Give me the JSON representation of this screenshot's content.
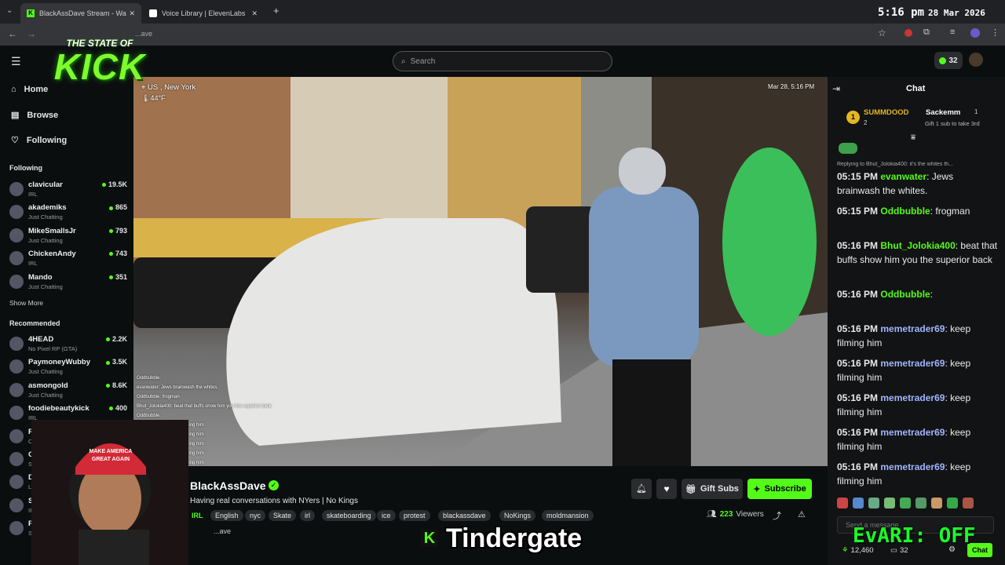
{
  "browser": {
    "tabs": [
      {
        "label": "BlackAssDave Stream - Wa"
      },
      {
        "label": "Voice Library | ElevenLabs"
      }
    ],
    "url": "...ave",
    "clock": "5:16 pm",
    "date": "28 Mar 2026"
  },
  "overlay": {
    "logo_top": "THE STATE OF",
    "logo_main": "KICK",
    "caption": "Tindergate",
    "caption_icon": "K",
    "evari": "EvARI: OFF"
  },
  "kick_header": {
    "search_placeholder": "Search",
    "kicks": "32"
  },
  "sidebar": {
    "nav": [
      {
        "label": "Home"
      },
      {
        "label": "Browse"
      },
      {
        "label": "Following"
      }
    ],
    "following_title": "Following",
    "following": [
      {
        "name": "clavicular",
        "category": "IRL",
        "viewers": "19.5K"
      },
      {
        "name": "akademiks",
        "category": "Just Chatting",
        "viewers": "865"
      },
      {
        "name": "MikeSmallsJr",
        "category": "Just Chatting",
        "viewers": "793"
      },
      {
        "name": "ChickenAndy",
        "category": "IRL",
        "viewers": "743"
      },
      {
        "name": "Mando",
        "category": "Just Chatting",
        "viewers": "351"
      }
    ],
    "show_more": "Show More",
    "recommended_title": "Recommended",
    "recommended": [
      {
        "name": "4HEAD",
        "category": "No Pixel RP (GTA)",
        "viewers": "2.2K"
      },
      {
        "name": "PaymoneyWubby",
        "category": "Just Chatting",
        "viewers": "3.5K"
      },
      {
        "name": "asmongold",
        "category": "Just Chatting",
        "viewers": "8.6K"
      },
      {
        "name": "foodiebeautykick",
        "category": "IRL",
        "viewers": "400"
      },
      {
        "name": "Raikesy",
        "category": "Old School Ru",
        "viewers": ""
      },
      {
        "name": "Classybee",
        "category": "Slots & Ca",
        "viewers": ""
      },
      {
        "name": "DJMi",
        "category": "Live",
        "viewers": ""
      },
      {
        "name": "Sa",
        "category": "IRL",
        "viewers": ""
      },
      {
        "name": "Fran",
        "category": "St",
        "viewers": ""
      }
    ]
  },
  "video": {
    "location": "US , New York",
    "temp": "44°F",
    "timestamp": "Mar 28, 5:16 PM",
    "mini_chat": [
      "Oddbubble:",
      "evanwater: Jews brainwash the whites.",
      "Oddbubble: frogman",
      "Bhut_Jolokia400: beat that buffs show him you the superior back",
      "Oddbubble:",
      "memetrader69: keep filming him",
      "memetrader69: keep filming him",
      "memetrader69: keep filming him",
      "memetrader69: keep filming him",
      "memetrader69: keep filming him"
    ]
  },
  "stream": {
    "channel": "BlackAssDave",
    "title": "Having real conversations with NYers | No Kings",
    "tags": [
      "IRL",
      "English",
      "nyc",
      "Skate",
      "irl",
      "skateboarding",
      "ice",
      "protest",
      "blackassdave",
      "NoKings",
      "moldmansion"
    ],
    "viewers": "223",
    "viewers_label": "Viewers",
    "gift_subs": "Gift Subs",
    "subscribe": "Subscribe",
    "about_link": "...ave"
  },
  "chat": {
    "title": "Chat",
    "leader1": {
      "rank": "1",
      "name": "SUMMDOOD",
      "count": "2"
    },
    "leader2": {
      "name": "Sackemm",
      "count": "1",
      "note": "Gift 1 sub to take 3rd"
    },
    "reply_note": "Replying to Bhut_Jolokia400: it's the whites th...",
    "messages": [
      {
        "time": "05:15 PM",
        "user": "evanwater",
        "text": "Jews brainwash the whites.",
        "color": "#53fc18"
      },
      {
        "time": "05:15 PM",
        "user": "Oddbubble",
        "text": "frogman",
        "color": "#53fc18"
      },
      {
        "time": "05:16 PM",
        "user": "Bhut_Jolokia400",
        "text": "beat that buffs show him you the superior back",
        "color": "#53fc18"
      },
      {
        "time": "05:16 PM",
        "user": "Oddbubble",
        "text": "",
        "color": "#53fc18"
      },
      {
        "time": "05:16 PM",
        "user": "memetrader69",
        "text": "keep filming him",
        "color": "#9fb5ff"
      },
      {
        "time": "05:16 PM",
        "user": "memetrader69",
        "text": "keep filming him",
        "color": "#9fb5ff"
      },
      {
        "time": "05:16 PM",
        "user": "memetrader69",
        "text": "keep filming him",
        "color": "#9fb5ff"
      },
      {
        "time": "05:16 PM",
        "user": "memetrader69",
        "text": "keep filming him",
        "color": "#9fb5ff"
      },
      {
        "time": "05:16 PM",
        "user": "memetrader69",
        "text": "keep filming him",
        "color": "#9fb5ff"
      }
    ],
    "input_placeholder": "Send a message",
    "points": "12,460",
    "subs": "32",
    "send": "Chat"
  },
  "colors": {
    "accent": "#53fc18",
    "bg": "#0b0e0f"
  }
}
